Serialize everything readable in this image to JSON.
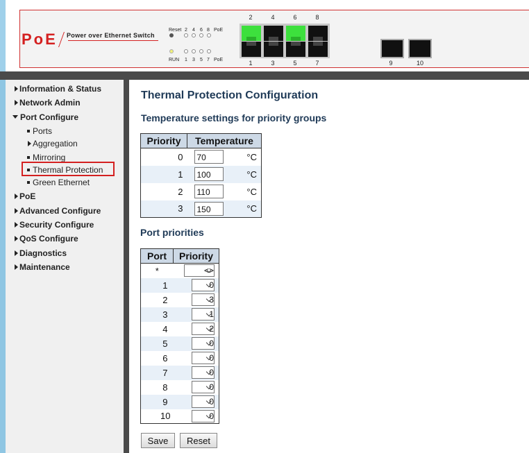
{
  "banner": {
    "logo_text": "PoE",
    "tagline": "Power over Ethernet Switch",
    "led_top_labels": [
      "Reset",
      "2",
      "4",
      "6",
      "8",
      "PoE"
    ],
    "led_bottom_labels": [
      "RUN",
      "1",
      "3",
      "5",
      "7",
      "PoE"
    ],
    "ports_top": [
      {
        "label": "2",
        "active": true
      },
      {
        "label": "4",
        "active": false
      },
      {
        "label": "6",
        "active": true
      },
      {
        "label": "8",
        "active": false
      }
    ],
    "ports_bottom": [
      {
        "label": "1",
        "active": false
      },
      {
        "label": "3",
        "active": false
      },
      {
        "label": "5",
        "active": false
      },
      {
        "label": "7",
        "active": false
      }
    ],
    "sfp_ports": [
      "9",
      "10"
    ],
    "colors": {
      "brand_red": "#d42020",
      "port_active": "#3de03d"
    }
  },
  "sidebar": {
    "items": [
      {
        "label": "Information & Status",
        "state": "collapsed"
      },
      {
        "label": "Network Admin",
        "state": "collapsed"
      },
      {
        "label": "Port Configure",
        "state": "expanded"
      },
      {
        "label": "Ports",
        "state": "leaf"
      },
      {
        "label": "Aggregation",
        "state": "collapsed"
      },
      {
        "label": "Mirroring",
        "state": "leaf"
      },
      {
        "label": "Thermal Protection",
        "state": "selected"
      },
      {
        "label": "Green Ethernet",
        "state": "leaf"
      },
      {
        "label": "PoE",
        "state": "collapsed"
      },
      {
        "label": "Advanced Configure",
        "state": "collapsed"
      },
      {
        "label": "Security Configure",
        "state": "collapsed"
      },
      {
        "label": "QoS Configure",
        "state": "collapsed"
      },
      {
        "label": "Diagnostics",
        "state": "collapsed"
      },
      {
        "label": "Maintenance",
        "state": "collapsed"
      }
    ]
  },
  "main": {
    "title": "Thermal Protection Configuration",
    "temp_section_title": "Temperature settings for priority groups",
    "temp_table": {
      "headers": [
        "Priority",
        "Temperature"
      ],
      "unit": "°C",
      "rows": [
        {
          "priority": "0",
          "temperature": "70"
        },
        {
          "priority": "1",
          "temperature": "100"
        },
        {
          "priority": "2",
          "temperature": "110"
        },
        {
          "priority": "3",
          "temperature": "150"
        }
      ]
    },
    "port_section_title": "Port priorities",
    "port_table": {
      "headers": [
        "Port",
        "Priority"
      ],
      "rows": [
        {
          "port": "*",
          "priority": "<>"
        },
        {
          "port": "1",
          "priority": "0"
        },
        {
          "port": "2",
          "priority": "3"
        },
        {
          "port": "3",
          "priority": "1"
        },
        {
          "port": "4",
          "priority": "2"
        },
        {
          "port": "5",
          "priority": "0"
        },
        {
          "port": "6",
          "priority": "0"
        },
        {
          "port": "7",
          "priority": "0"
        },
        {
          "port": "8",
          "priority": "0"
        },
        {
          "port": "9",
          "priority": "0"
        },
        {
          "port": "10",
          "priority": "0"
        }
      ]
    },
    "save_label": "Save",
    "reset_label": "Reset"
  }
}
